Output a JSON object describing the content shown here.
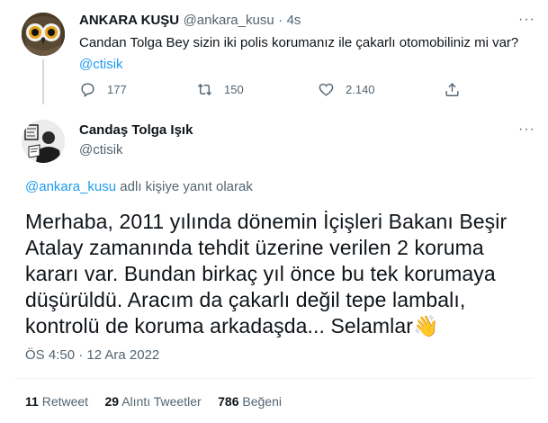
{
  "reply": {
    "author_name": "ANKARA KUŞU",
    "author_handle": "@ankara_kusu",
    "time": "4s",
    "text": "Candan Tolga Bey sizin iki polis korumanız ile çakarlı otomobiliniz mi var?",
    "mention": "@ctisik",
    "more_icon": "more-dots-icon",
    "actions": {
      "reply_count": "177",
      "retweet_count": "150",
      "like_count": "2.140",
      "reply_icon": "comment-icon",
      "retweet_icon": "retweet-icon",
      "like_icon": "heart-icon",
      "share_icon": "share-icon"
    }
  },
  "main": {
    "author_name": "Candaş Tolga Işık",
    "author_handle": "@ctisik",
    "replying_handle": "@ankara_kusu",
    "replying_suffix": "adlı kişiye yanıt olarak",
    "text": "Merhaba, 2011 yılında dönemin İçişleri Bakanı Beşir Atalay zamanında tehdit üzerine verilen 2 koruma kararı var. Bundan birkaç yıl önce bu tek korumaya düşürüldü. Aracım da çakarlı değil tepe lambalı, kontrolü de koruma arkadaşda... Selamlar",
    "emoji": "👋",
    "timestamp": "ÖS 4:50 · 12 Ara 2022",
    "stats": {
      "retweets_count": "11",
      "retweets_label": "Retweet",
      "quotes_count": "29",
      "quotes_label": "Alıntı Tweetler",
      "likes_count": "786",
      "likes_label": "Beğeni"
    }
  },
  "colors": {
    "link": "#1d9bf0",
    "muted": "#536471",
    "text": "#0f1419"
  }
}
